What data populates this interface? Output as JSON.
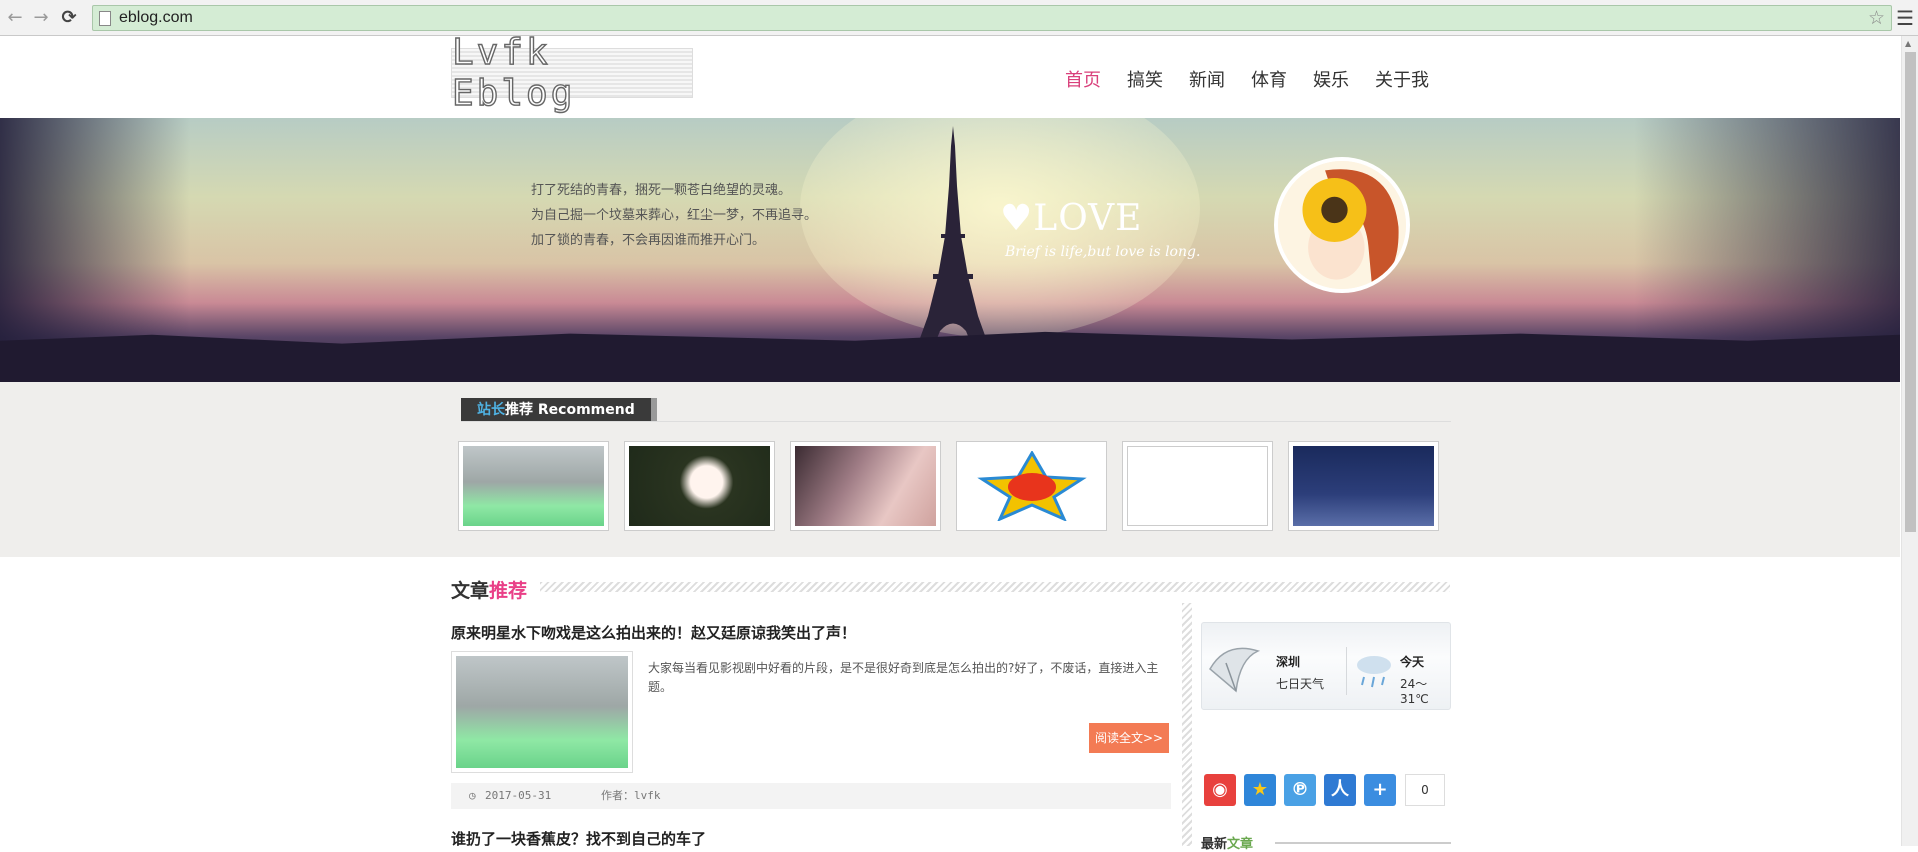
{
  "browser": {
    "url": "eblog.com"
  },
  "site": {
    "logo": "Lvfk Eblog",
    "nav": [
      "首页",
      "搞笑",
      "新闻",
      "体育",
      "娱乐",
      "关于我"
    ]
  },
  "banner": {
    "poem": [
      "打了死结的青春，捆死一颗苍白绝望的灵魂。",
      "为自己掘一个坟墓来葬心，红尘一梦，不再追寻。",
      "加了锁的青春，不会再因谁而推开心门。"
    ],
    "love_title": "LOVE",
    "love_sub": "Brief is life,but love is long."
  },
  "recommend": {
    "title_highlight": "站长",
    "title_rest": "推荐 Recommend"
  },
  "articles": {
    "section_title": "文章",
    "section_title_highlight": "推荐",
    "items": [
      {
        "title": "原来明星水下吻戏是这么拍出来的！赵又廷原谅我笑出了声！",
        "excerpt": "大家每当看见影视剧中好看的片段，是不是很好奇到底是怎么拍出的?好了，不废话，直接进入主题。",
        "read_more": "阅读全文>>",
        "date": "2017-05-31",
        "author": "作者：lvfk"
      },
      {
        "title": "谁扔了一块香蕉皮？找不到自己的车了"
      }
    ]
  },
  "weather": {
    "city": "深圳",
    "week": "七日天气",
    "today": "今天",
    "temp": "24～31℃"
  },
  "share": {
    "count": "0"
  },
  "latest": {
    "title": "最新",
    "title_highlight": "文章"
  },
  "colors": {
    "nav_active": "#d9407b",
    "read_more": "#f37b54",
    "section_pink": "#e93f87",
    "recommend_blue": "#4fb2e3"
  }
}
